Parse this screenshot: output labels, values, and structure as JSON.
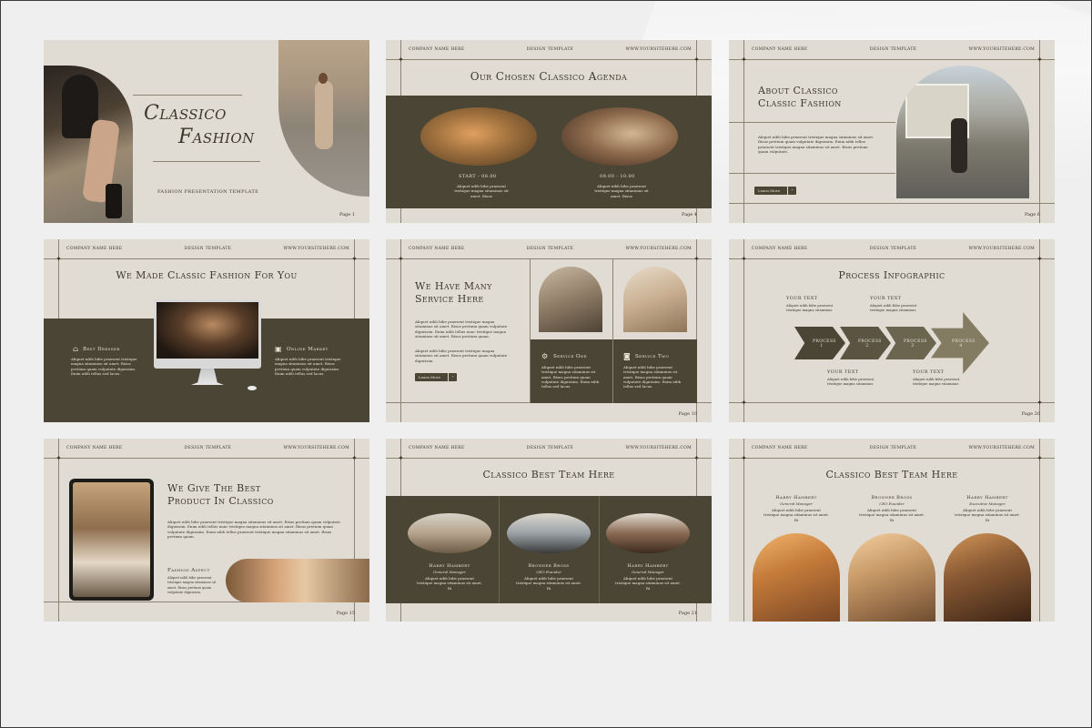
{
  "common": {
    "company": "COMPANY NAME HERE",
    "template": "DESIGN TEMPLATE",
    "website": "WWW.YOURSITEHERE.COM"
  },
  "slide1": {
    "title_line1": "Classico",
    "title_line2": "Fashion",
    "subtitle": "FASHION PRESENTATION TEMPLATE",
    "page": "Page 1"
  },
  "slide2": {
    "title": "Our Chosen Classico Agenda",
    "item1_time": "START  -  08.00",
    "item2_time": "09.00  -  10.00",
    "item1_text": "Aliquet nibh bibe praesent tristique magna sitaminus sit amet. Risus",
    "item2_text": "Aliquet nibh bibe praesent tristique magna sitaminus sit amet. Risus",
    "page": "Page 4"
  },
  "slide3": {
    "title_line1": "About Classico",
    "title_line2": "Classic Fashion",
    "body": "Aliquet nibh bibe praesent tristique magna sitaminus sit amet. Risus pretium quam vulputate dignissim. Enim nibh tellus praesent tristique magna sitaminus sit amet. Risus pretium quam vulputate.",
    "button": "Learn More",
    "page": "Page 6"
  },
  "slide4": {
    "title": "We Made Classic Fashion For You",
    "feature1_title": "Best Dresser",
    "feature1_text": "Aliquet nibh bibe praesent tristique magna sitaminus sit amet. Risus pretium quam vulputate dignissim. Enim nibh tellus sed lacus.",
    "feature2_title": "Online Market",
    "feature2_text": "Aliquet nibh bibe praesent tristique magna sitaminus sit amet. Risus pretium quam vulputate dignissim. Enim nibh tellus sed lacus."
  },
  "slide5": {
    "title_line1": "We Have Many",
    "title_line2": "Service Here",
    "body1": "Aliquet nibh bibe praesent tristique magna sitaminus sit amet. Risus pretium quam vulputate dignissim. Enim nibh tellus nunc tristique magna sitaminus sit amet. Risus pretium quam.",
    "body2": "Aliquet nibh bibe praesent tristique magna sitaminus sit amet. Risus pretium quam vulputate dignissim.",
    "button": "Learn More",
    "service1_title": "Service One",
    "service1_text": "Aliquet nibh bibe praesent tristique magna sitaminus sit amet. Risus pretium quam vulputate dignissim. Enim nibh tellus sed lacus.",
    "service2_title": "Service Two",
    "service2_text": "Aliquet nibh bibe praesent tristique magna sitaminus sit amet. Risus pretium quam vulputate dignissim. Enim nibh tellus sed lacus.",
    "page": "Page 10"
  },
  "slide6": {
    "title": "Process Infographic",
    "arrows": [
      "PROCESS 1",
      "PROCESS 2",
      "PROCESS 3",
      "PROCESS 4"
    ],
    "labels_top": [
      "YOUR TEXT",
      "YOUR TEXT"
    ],
    "labels_bottom": [
      "YOUR TEXT",
      "YOUR TEXT"
    ],
    "label_text": "Aliquet nibh bibe praesent tristique magna sitaminus",
    "page": "Page 20"
  },
  "slide7": {
    "title_line1": "We Give The Best",
    "title_line2": "Product In Classico",
    "body": "Aliquet nibh bibe praesent tristique magna sitaminus sit amet. Risus pretium quam vulputate dignissim. Enim nibh tellus nunc tristique magna sitaminus sit amet. Risus pretium quam vulputate dignissim. Enim nibh tellus praesent tristique magna sitaminus sit amet. Risus pretium quam.",
    "aspect_title": "Fashion Aspect",
    "aspect_text": "Aliquet nibh bibe praesent tristique magna sitaminus sit amet. Risus pretium quam vulputate dignissim.",
    "page": "Page 15"
  },
  "slide8": {
    "title": "Classico Best Team Here",
    "members": [
      {
        "name": "Harry Hambert",
        "role": "General Manager",
        "text": "Aliquet nibh bibe praesent tristique magna sitaminus sit amet. Ri"
      },
      {
        "name": "Bronner Bross",
        "role": "CEO Founder",
        "text": "Aliquet nibh bibe praesent tristique magna sitaminus sit amet. Ri"
      },
      {
        "name": "Harry Hambert",
        "role": "General Manager",
        "text": "Aliquet nibh bibe praesent tristique magna sitaminus sit amet. Ri"
      }
    ],
    "page": "Page 21"
  },
  "slide9": {
    "title": "Classico Best Team Here",
    "members": [
      {
        "name": "Harry Hambert",
        "role": "General Manager",
        "text": "Aliquet nibh bibe praesent tristique magna sitaminus sit amet. Ri"
      },
      {
        "name": "Bronner Bross",
        "role": "CEO Founder",
        "text": "Aliquet nibh bibe praesent tristique magna sitaminus sit amet. Ri"
      },
      {
        "name": "Harry Hambert",
        "role": "Executive Manager",
        "text": "Aliquet nibh bibe praesent tristique magna sitaminus sit amet. Ri"
      }
    ]
  },
  "colors": {
    "background": "#efefef",
    "slide": "#e1dcd3",
    "dark_panel": "#4a4534",
    "ink": "#3b3729"
  }
}
